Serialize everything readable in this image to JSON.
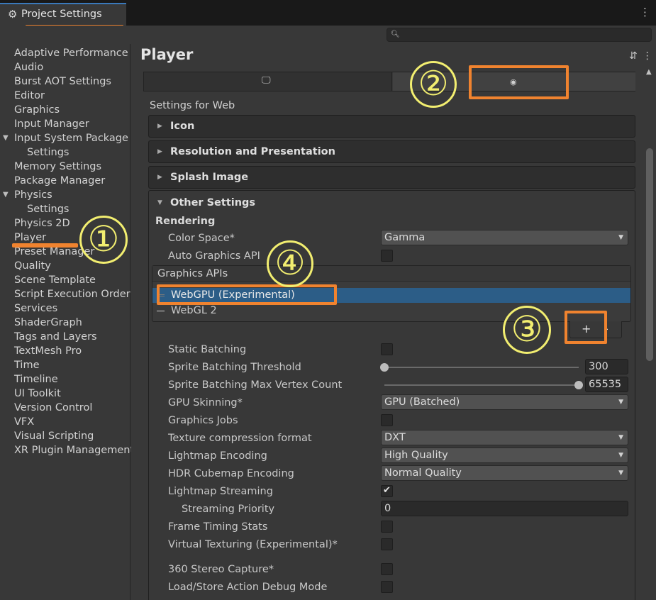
{
  "window": {
    "tab_title": "Project Settings",
    "search_placeholder": ""
  },
  "sidebar": {
    "items": [
      {
        "label": "Adaptive Performance"
      },
      {
        "label": "Audio"
      },
      {
        "label": "Burst AOT Settings"
      },
      {
        "label": "Editor"
      },
      {
        "label": "Graphics"
      },
      {
        "label": "Input Manager"
      },
      {
        "label": "Input System Package"
      },
      {
        "label": "Settings"
      },
      {
        "label": "Memory Settings"
      },
      {
        "label": "Package Manager"
      },
      {
        "label": "Physics"
      },
      {
        "label": "Settings"
      },
      {
        "label": "Physics 2D"
      },
      {
        "label": "Player"
      },
      {
        "label": "Preset Manager"
      },
      {
        "label": "Quality"
      },
      {
        "label": "Scene Template"
      },
      {
        "label": "Script Execution Order"
      },
      {
        "label": "Services"
      },
      {
        "label": "ShaderGraph"
      },
      {
        "label": "Tags and Layers"
      },
      {
        "label": "TextMesh Pro"
      },
      {
        "label": "Time"
      },
      {
        "label": "Timeline"
      },
      {
        "label": "UI Toolkit"
      },
      {
        "label": "Version Control"
      },
      {
        "label": "VFX"
      },
      {
        "label": "Visual Scripting"
      },
      {
        "label": "XR Plugin Management"
      }
    ],
    "selected": "Player"
  },
  "main": {
    "title": "Player",
    "platform_tabs": [
      {
        "icon": "monitor-icon",
        "selected": false
      },
      {
        "icon": "web-icon",
        "selected": true
      }
    ],
    "settings_for": "Settings for Web",
    "sections": [
      {
        "label": "Icon",
        "expanded": false
      },
      {
        "label": "Resolution and Presentation",
        "expanded": false
      },
      {
        "label": "Splash Image",
        "expanded": false
      },
      {
        "label": "Other Settings",
        "expanded": true
      }
    ],
    "rendering": {
      "heading": "Rendering",
      "color_space": {
        "label": "Color Space*",
        "value": "Gamma"
      },
      "auto_graphics_api": {
        "label": "Auto Graphics API",
        "checked": false
      },
      "graphics_apis": {
        "header": "Graphics APIs",
        "items": [
          {
            "label": "WebGPU (Experimental)",
            "selected": true
          },
          {
            "label": "WebGL 2",
            "selected": false
          }
        ],
        "add_label": "+",
        "remove_label": "-"
      },
      "static_batching": {
        "label": "Static Batching",
        "checked": false
      },
      "sprite_batching_threshold": {
        "label": "Sprite Batching Threshold",
        "value": "300",
        "fraction": 0.0
      },
      "sprite_batching_max_vertex": {
        "label": "Sprite Batching Max Vertex Count",
        "value": "65535",
        "fraction": 1.0
      },
      "gpu_skinning": {
        "label": "GPU Skinning*",
        "value": "GPU (Batched)"
      },
      "graphics_jobs": {
        "label": "Graphics Jobs",
        "checked": false
      },
      "texture_compression": {
        "label": "Texture compression format",
        "value": "DXT"
      },
      "lightmap_encoding": {
        "label": "Lightmap Encoding",
        "value": "High Quality"
      },
      "hdr_cubemap_encoding": {
        "label": "HDR Cubemap Encoding",
        "value": "Normal Quality"
      },
      "lightmap_streaming": {
        "label": "Lightmap Streaming",
        "checked": true
      },
      "streaming_priority": {
        "label": "Streaming Priority",
        "value": "0"
      },
      "frame_timing_stats": {
        "label": "Frame Timing Stats",
        "checked": false
      },
      "virtual_texturing": {
        "label": "Virtual Texturing (Experimental)*",
        "checked": false
      },
      "stereo_capture": {
        "label": "360 Stereo Capture*",
        "checked": false
      },
      "load_store_debug": {
        "label": "Load/Store Action Debug Mode",
        "checked": false
      }
    }
  },
  "annotations": [
    {
      "number": "①"
    },
    {
      "number": "②"
    },
    {
      "number": "③"
    },
    {
      "number": "④"
    }
  ],
  "colors": {
    "annotation_box": "#f0832f",
    "annotation_number": "#f2ee70",
    "selection": "#2c5d87"
  }
}
